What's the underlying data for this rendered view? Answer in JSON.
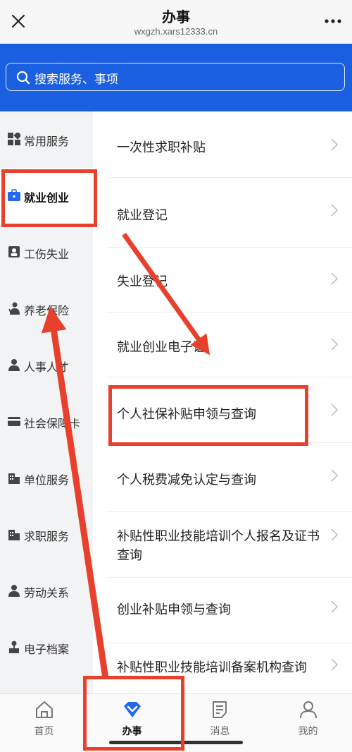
{
  "topbar": {
    "title": "办事",
    "url": "wxgzh.xars12333.cn",
    "close_icon": "close-icon",
    "more_icon": "more-icon"
  },
  "search": {
    "placeholder": "搜索服务、事项",
    "icon": "search-icon"
  },
  "sidebar": {
    "items": [
      {
        "label": "常用服务",
        "icon": "grid-icon"
      },
      {
        "label": "就业创业",
        "icon": "briefcase-icon",
        "active": true
      },
      {
        "label": "工伤失业",
        "icon": "id-card-icon"
      },
      {
        "label": "养老保险",
        "icon": "elder-icon"
      },
      {
        "label": "人事人才",
        "icon": "person-icon"
      },
      {
        "label": "社会保障卡",
        "icon": "card-icon"
      },
      {
        "label": "单位服务",
        "icon": "building-icon"
      },
      {
        "label": "求职服务",
        "icon": "building-icon"
      },
      {
        "label": "劳动关系",
        "icon": "person-icon"
      },
      {
        "label": "电子档案",
        "icon": "org-icon"
      }
    ]
  },
  "services": [
    {
      "label": "一次性求职补贴"
    },
    {
      "label": "就业登记"
    },
    {
      "label": "失业登记"
    },
    {
      "label": "就业创业电子证"
    },
    {
      "label": "个人社保补贴申领与查询"
    },
    {
      "label": "个人税费减免认定与查询"
    },
    {
      "label": "补贴性职业技能培训个人报名及证书查询"
    },
    {
      "label": "创业补贴申领与查询"
    },
    {
      "label": "补贴性职业技能培训备案机构查询"
    }
  ],
  "bottom_nav": [
    {
      "label": "首页",
      "icon": "home-icon"
    },
    {
      "label": "办事",
      "icon": "service-diamond-icon",
      "active": true
    },
    {
      "label": "消息",
      "icon": "message-icon"
    },
    {
      "label": "我的",
      "icon": "profile-icon"
    }
  ],
  "colors": {
    "header_blue": "#1a5fe0",
    "annotation_red": "#e8402c",
    "active_icon_blue": "#2468f2"
  }
}
